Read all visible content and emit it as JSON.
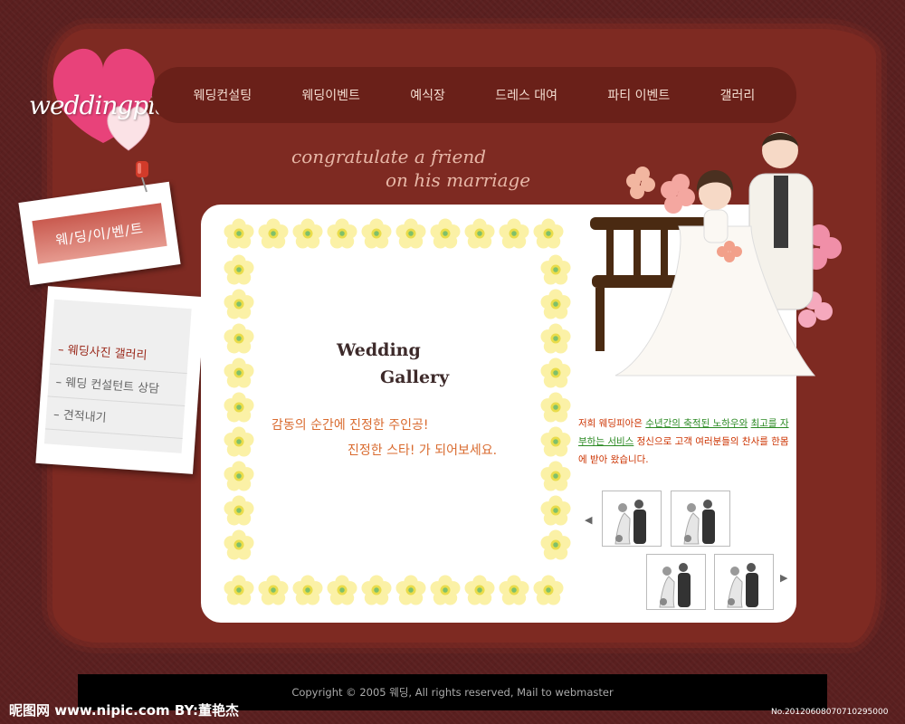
{
  "brand": {
    "logo_text": "weddingpia"
  },
  "nav": {
    "items": [
      "웨딩컨설팅",
      "웨딩이벤트",
      "예식장",
      "드레스 대여",
      "파티 이벤트",
      "갤러리"
    ]
  },
  "tagline": {
    "line1": "congratulate a friend",
    "line2": "on his marriage"
  },
  "section_badge": "웨/딩/이/벤/트",
  "side_menu": {
    "items": [
      "– 웨딩사진 갤러리",
      "– 웨딩 컨설턴트 상담",
      "– 견적내기"
    ],
    "active_index": 0
  },
  "gallery": {
    "title_line1": "Wedding",
    "title_line2": "Gallery",
    "slogan_line1": "감동의 순간에 진정한 주인공!",
    "slogan_line2": "진정한 스타! 가 되어보세요."
  },
  "description": {
    "part1": "저희 웨딩피아은 ",
    "highlight1": "수년간의 축적된 노하우와",
    "highlight2": "최고를 자부하는 서비스",
    "part2": " 정신으로 고객 여러분들의 찬사를 한몸에 받아 왔습니다."
  },
  "thumbnails": {
    "icon": "couple-photo-icon",
    "count": 4
  },
  "footer": {
    "copyright": "Copyright © 2005 웨딩, All rights reserved, Mail to webmaster"
  },
  "watermark": {
    "left": "昵图网 www.nipic.com  BY:董艳杰",
    "right": "No.20120608070710295000"
  },
  "colors": {
    "background": "#5a1f1f",
    "frame": "#7e2a22",
    "nav": "#6a2019",
    "accent_orange": "#d96a2e",
    "accent_green": "#2c8a24"
  }
}
